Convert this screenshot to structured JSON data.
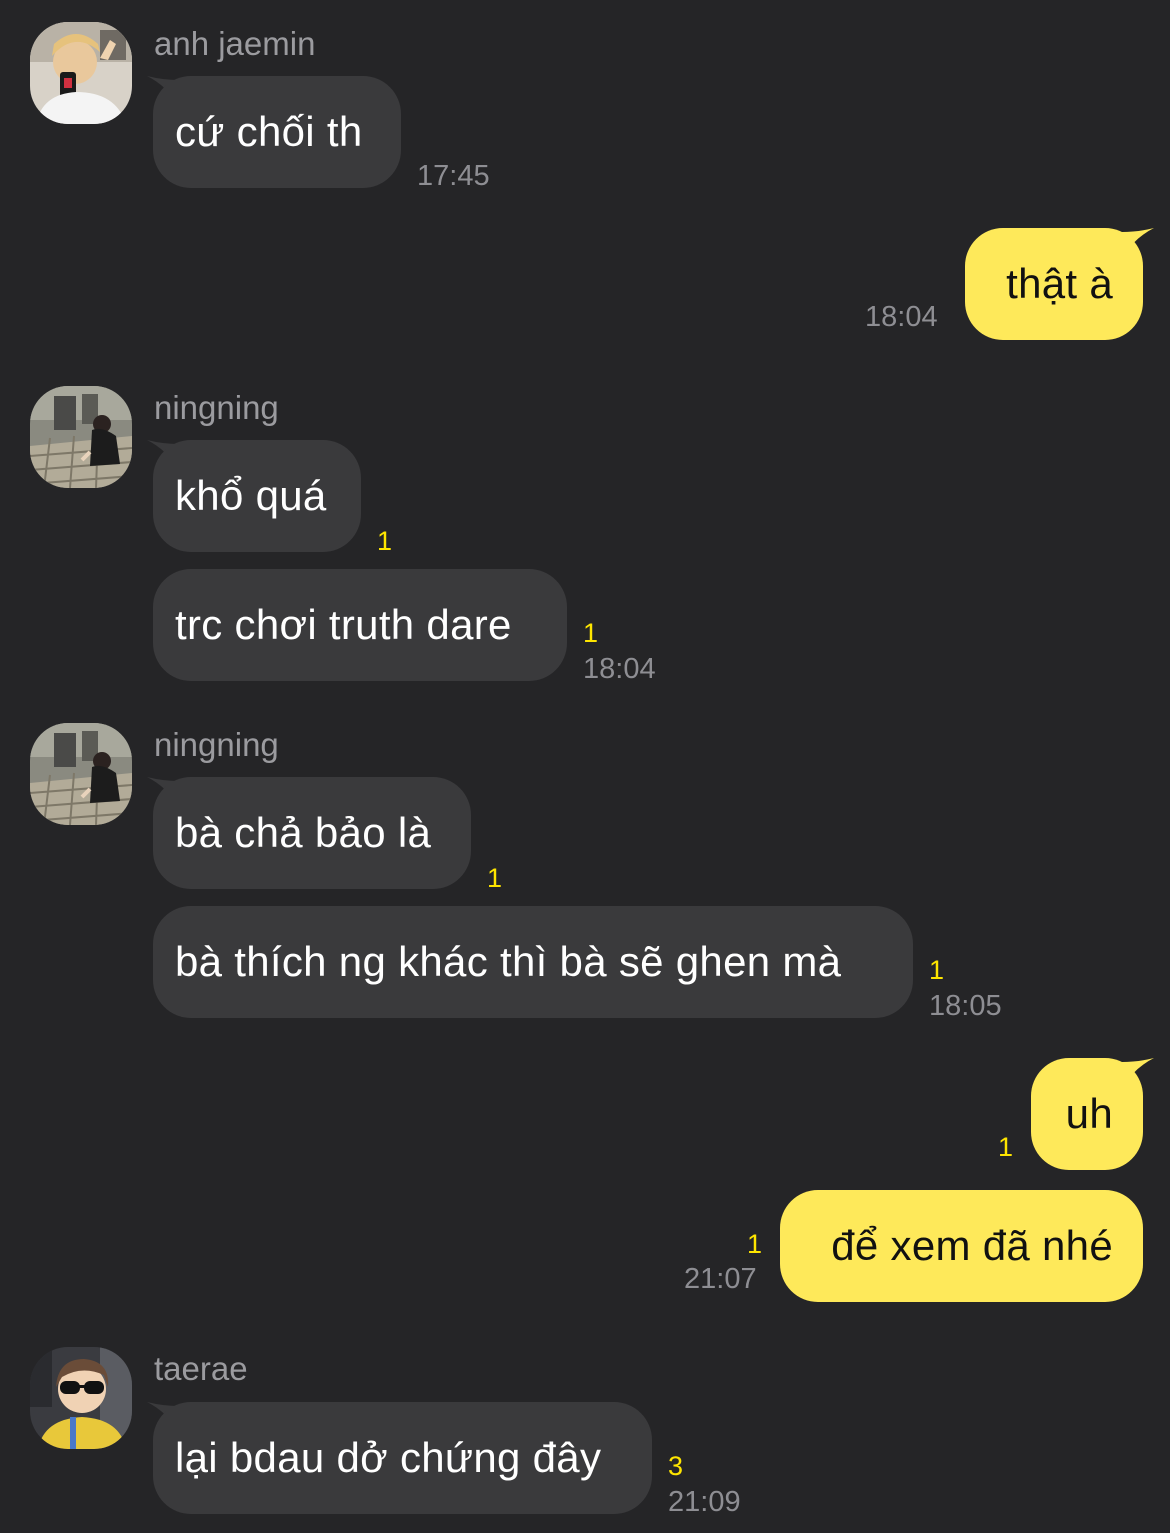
{
  "colors": {
    "background": "#252527",
    "incoming_bubble": "#3a3a3c",
    "outgoing_bubble": "#fee95a",
    "unread_count": "#fee500",
    "meta_text": "#8e8e93"
  },
  "messages": [
    {
      "sender": "anh jaemin",
      "avatar_icon": "profile-photo-icon",
      "text": "cứ chối th",
      "time": "17:45"
    },
    {
      "text": "thật à",
      "time": "18:04",
      "direction": "outgoing"
    },
    {
      "sender": "ningning",
      "avatar_icon": "profile-photo-icon",
      "text": "khổ quá",
      "unread": "1"
    },
    {
      "text": "trc chơi truth dare",
      "unread": "1",
      "time": "18:04"
    },
    {
      "sender": "ningning",
      "avatar_icon": "profile-photo-icon",
      "text": "bà chả bảo là",
      "unread": "1"
    },
    {
      "text": "bà thích ng khác thì bà sẽ ghen mà",
      "unread": "1",
      "time": "18:05"
    },
    {
      "text": "uh",
      "unread": "1",
      "direction": "outgoing"
    },
    {
      "text": "để xem đã nhé",
      "unread": "1",
      "time": "21:07",
      "direction": "outgoing"
    },
    {
      "sender": "taerae",
      "avatar_icon": "profile-photo-icon",
      "text": "lại bdau dở chứng đây",
      "unread": "3",
      "time": "21:09"
    }
  ]
}
